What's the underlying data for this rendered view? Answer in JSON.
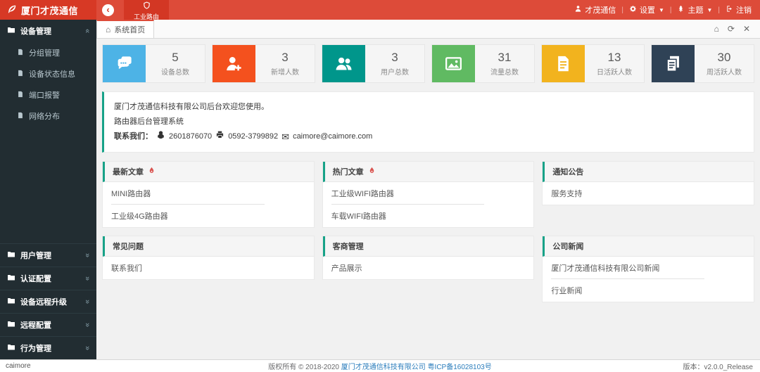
{
  "header": {
    "logo": "厦门才茂通信",
    "menu_router": "工业路由",
    "user": "才茂通信",
    "settings": "设置",
    "theme": "主题",
    "logout": "注销"
  },
  "sidebar": {
    "group_device": "设备管理",
    "device_children": [
      "分组管理",
      "设备状态信息",
      "端口报警",
      "网络分布"
    ],
    "collapsed_groups": [
      "用户管理",
      "认证配置",
      "设备远程升级",
      "远程配置",
      "行为管理"
    ]
  },
  "tabbar": {
    "active_tab": "系统首页"
  },
  "stats": [
    {
      "icon": "comments-icon",
      "color": "#4db3e6",
      "value": "5",
      "label": "设备总数"
    },
    {
      "icon": "user-plus-icon",
      "color": "#f4511e",
      "value": "3",
      "label": "新增人数"
    },
    {
      "icon": "users-icon",
      "color": "#00968b",
      "value": "3",
      "label": "用户总数"
    },
    {
      "icon": "image-icon",
      "color": "#60ba62",
      "value": "31",
      "label": "流量总数"
    },
    {
      "icon": "file-icon",
      "color": "#f2b31e",
      "value": "13",
      "label": "日活跃人数"
    },
    {
      "icon": "copy-icon",
      "color": "#2f4256",
      "value": "30",
      "label": "周活跃人数"
    }
  ],
  "welcome": {
    "line1": "厦门才茂通信科技有限公司后台欢迎您使用。",
    "line2": "路由器后台管理系统",
    "contact_label": "联系我们：",
    "qq": "2601876070",
    "phone": "0592-3799892",
    "email": "caimore@caimore.com"
  },
  "panels": [
    {
      "title": "最新文章",
      "items": [
        "MINI路由器",
        "工业级4G路由器"
      ]
    },
    {
      "title": "热门文章",
      "items": [
        "工业级WIFI路由器",
        "车载WIFI路由器"
      ]
    },
    {
      "title": "通知公告",
      "items": [
        "服务支持"
      ]
    },
    {
      "title": "常见问题",
      "items": [
        "联系我们"
      ]
    },
    {
      "title": "客商管理",
      "items": [
        "产品展示"
      ]
    },
    {
      "title": "公司新闻",
      "items": [
        "厦门才茂通信科技有限公司新闻",
        "行业新闻"
      ]
    }
  ],
  "footer": {
    "left": "caimore",
    "copyright": "版权所有 © 2018-2020 ",
    "company_link": "厦门才茂通信科技有限公司",
    "icp_link": "粤ICP备16028103号",
    "version": "版本：v2.0.0_Release"
  },
  "colors": {
    "header_red": "#dd4b39",
    "sidebar_dark": "#222d32",
    "accent_teal": "#17a288"
  }
}
